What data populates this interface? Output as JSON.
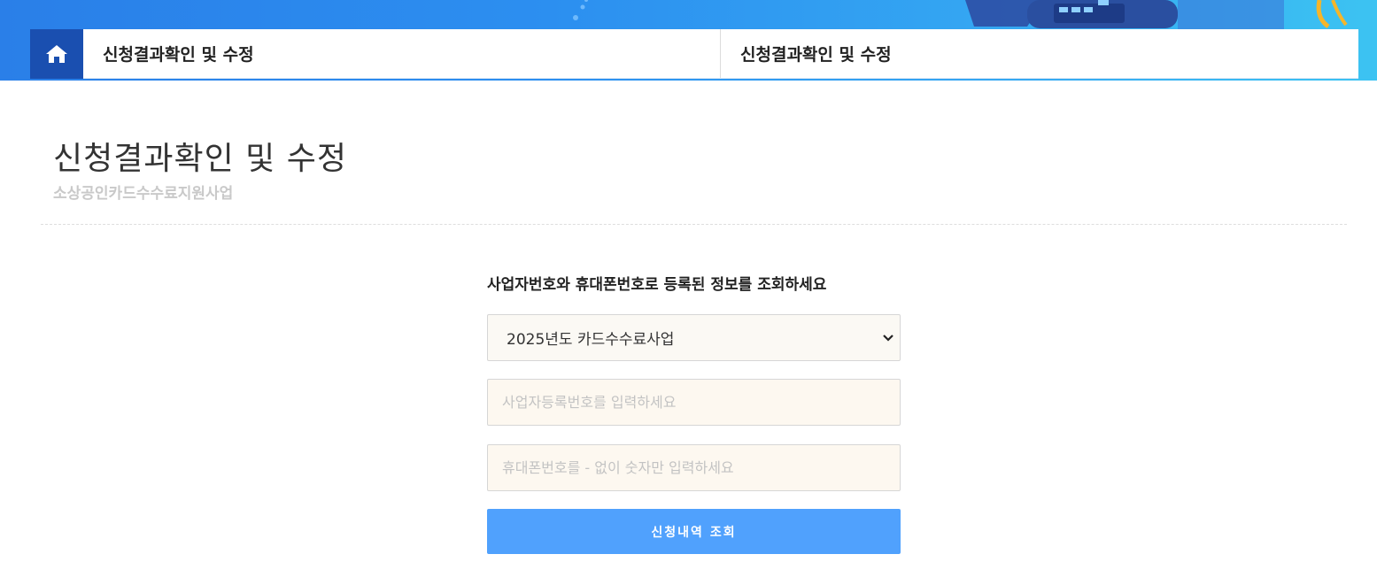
{
  "breadcrumb": {
    "home_icon": "home-icon",
    "items": [
      {
        "label": "신청결과확인 및 수정"
      },
      {
        "label": "신청결과확인 및 수정"
      }
    ]
  },
  "page": {
    "title": "신청결과확인 및 수정",
    "subtitle": "소상공인카드수수료지원사업"
  },
  "form": {
    "instruction": "사업자번호와 휴대폰번호로 등록된 정보를 조회하세요",
    "year_select": {
      "selected": "2025년도 카드수수료사업",
      "icon": "chevron-down-icon"
    },
    "business_number": {
      "value": "",
      "placeholder": "사업자등록번호를 입력하세요"
    },
    "phone_number": {
      "value": "",
      "placeholder": "휴대폰번호를 - 없이 숫자만 입력하세요"
    },
    "submit_label": "신청내역 조회"
  },
  "colors": {
    "banner_start": "#2a7fe8",
    "banner_end": "#3cc3f2",
    "home_button": "#1a4fb0",
    "submit_button": "#50a1fd"
  }
}
